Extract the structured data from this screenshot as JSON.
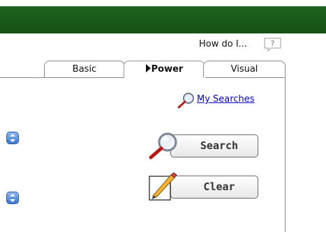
{
  "header": {
    "help_label": "How do I...",
    "help_icon": "help-question-icon"
  },
  "tabs": [
    {
      "label": "Basic",
      "active": false
    },
    {
      "label": "Power",
      "active": true
    },
    {
      "label": "Visual",
      "active": false
    }
  ],
  "links": {
    "my_searches": "My Searches"
  },
  "buttons": {
    "search": "Search",
    "clear": "Clear"
  },
  "colors": {
    "top_bar": "#1c5c1c",
    "link": "#0000cc",
    "spinner": "#3d76cc"
  }
}
